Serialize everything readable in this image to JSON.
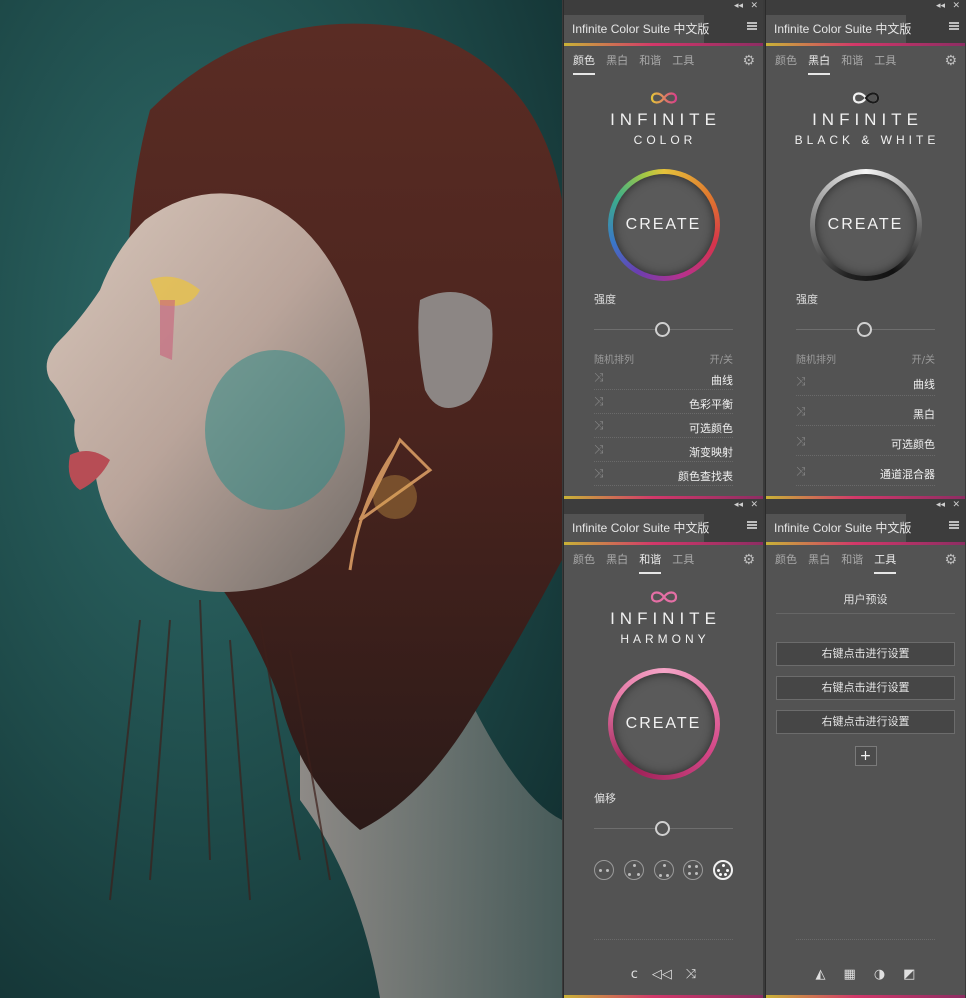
{
  "panels": {
    "color": {
      "title": "Infinite Color Suite 中文版",
      "tabs": [
        "颜色",
        "黑白",
        "和谐",
        "工具"
      ],
      "active_tab": "颜色",
      "brand": "INFINITE",
      "brand_sub": "COLOR",
      "create_label": "CREATE",
      "slider_label": "强度",
      "slider_value": 0.5,
      "random_header": "随机排列",
      "toggle_header": "开/关",
      "rows": [
        "曲线",
        "色彩平衡",
        "可选颜色",
        "渐变映射",
        "颜色查找表"
      ]
    },
    "bw": {
      "title": "Infinite Color Suite 中文版",
      "tabs": [
        "颜色",
        "黑白",
        "和谐",
        "工具"
      ],
      "active_tab": "黑白",
      "brand": "INFINITE",
      "brand_sub": "BLACK & WHITE",
      "create_label": "CREATE",
      "slider_label": "强度",
      "slider_value": 0.5,
      "random_header": "随机排列",
      "toggle_header": "开/关",
      "rows": [
        "曲线",
        "黑白",
        "可选颜色",
        "通道混合器"
      ]
    },
    "harmony": {
      "title": "Infinite Color Suite 中文版",
      "tabs": [
        "颜色",
        "黑白",
        "和谐",
        "工具"
      ],
      "active_tab": "和谐",
      "brand": "INFINITE",
      "brand_sub": "HARMONY",
      "create_label": "CREATE",
      "slider_label": "偏移",
      "slider_value": 0.5,
      "harmony_modes": 5,
      "selected_mode": 5,
      "footer": [
        "c",
        "◁◁",
        "⤨"
      ]
    },
    "tools": {
      "title": "Infinite Color Suite 中文版",
      "tabs": [
        "颜色",
        "黑白",
        "和谐",
        "工具"
      ],
      "active_tab": "工具",
      "presets_title": "用户预设",
      "preset_buttons": [
        "右键点击进行设置",
        "右键点击进行设置",
        "右键点击进行设置"
      ],
      "add_label": "+",
      "footer": [
        "◭",
        "▦",
        "◑",
        "◩"
      ]
    }
  },
  "colors": {
    "panel_bg": "#535353",
    "header_bg": "#3d3d3d",
    "accent_gold": "#c9b237",
    "accent_pink": "#d2386a",
    "photo_teal": "#1f4d4c"
  },
  "icons": [
    "infinity-icon",
    "gear-icon",
    "shuffle-icon",
    "menu-icon",
    "collapse-icon",
    "close-icon"
  ]
}
